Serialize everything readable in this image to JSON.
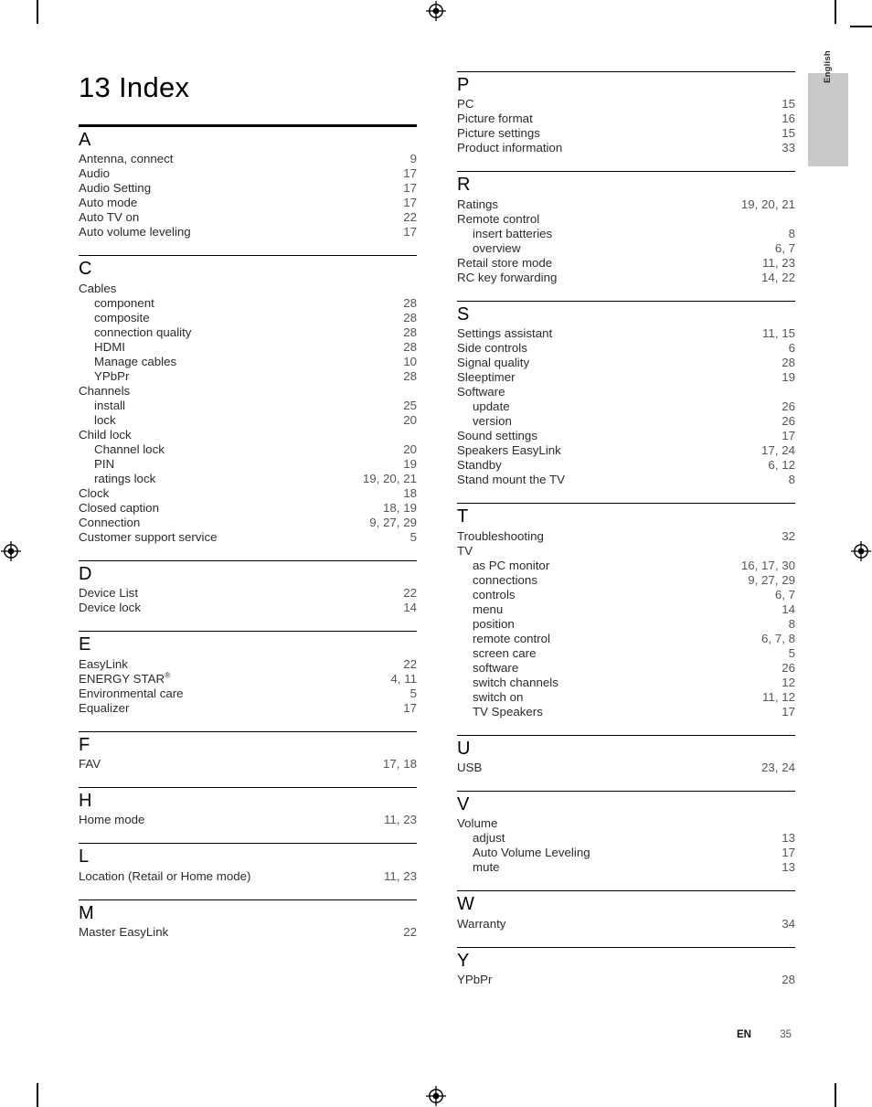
{
  "page": {
    "title": "13 Index",
    "language_tab": "English",
    "footer": {
      "language_code": "EN",
      "page_number": "35"
    }
  },
  "left_column": [
    {
      "letter": "A",
      "entries": [
        {
          "label": "Antenna, connect",
          "pages": "9",
          "sub": false
        },
        {
          "label": "Audio",
          "pages": "17",
          "sub": false
        },
        {
          "label": "Audio Setting",
          "pages": "17",
          "sub": false
        },
        {
          "label": "Auto mode",
          "pages": "17",
          "sub": false
        },
        {
          "label": "Auto TV on",
          "pages": "22",
          "sub": false
        },
        {
          "label": "Auto volume leveling",
          "pages": "17",
          "sub": false
        }
      ]
    },
    {
      "letter": "C",
      "entries": [
        {
          "label": "Cables",
          "pages": "",
          "sub": false
        },
        {
          "label": "component",
          "pages": "28",
          "sub": true
        },
        {
          "label": "composite",
          "pages": "28",
          "sub": true
        },
        {
          "label": "connection quality",
          "pages": "28",
          "sub": true
        },
        {
          "label": "HDMI",
          "pages": "28",
          "sub": true
        },
        {
          "label": "Manage cables",
          "pages": "10",
          "sub": true
        },
        {
          "label": "YPbPr",
          "pages": "28",
          "sub": true
        },
        {
          "label": "Channels",
          "pages": "",
          "sub": false
        },
        {
          "label": "install",
          "pages": "25",
          "sub": true
        },
        {
          "label": "lock",
          "pages": "20",
          "sub": true
        },
        {
          "label": "Child lock",
          "pages": "",
          "sub": false
        },
        {
          "label": "Channel lock",
          "pages": "20",
          "sub": true
        },
        {
          "label": "PIN",
          "pages": "19",
          "sub": true
        },
        {
          "label": "ratings lock",
          "pages": "19, 20, 21",
          "sub": true
        },
        {
          "label": "Clock",
          "pages": "18",
          "sub": false
        },
        {
          "label": "Closed caption",
          "pages": "18, 19",
          "sub": false
        },
        {
          "label": "Connection",
          "pages": "9, 27, 29",
          "sub": false
        },
        {
          "label": "Customer support service",
          "pages": "5",
          "sub": false
        }
      ]
    },
    {
      "letter": "D",
      "entries": [
        {
          "label": "Device List",
          "pages": "22",
          "sub": false
        },
        {
          "label": "Device lock",
          "pages": "14",
          "sub": false
        }
      ]
    },
    {
      "letter": "E",
      "entries": [
        {
          "label": "EasyLink",
          "pages": "22",
          "sub": false
        },
        {
          "label": "ENERGY STAR",
          "superscript": "®",
          "pages": "4, 11",
          "sub": false
        },
        {
          "label": "Environmental care",
          "pages": "5",
          "sub": false
        },
        {
          "label": "Equalizer",
          "pages": "17",
          "sub": false
        }
      ]
    },
    {
      "letter": "F",
      "entries": [
        {
          "label": "FAV",
          "pages": "17, 18",
          "sub": false
        }
      ]
    },
    {
      "letter": "H",
      "entries": [
        {
          "label": "Home mode",
          "pages": "11, 23",
          "sub": false
        }
      ]
    },
    {
      "letter": "L",
      "entries": [
        {
          "label": "Location (Retail or Home mode)",
          "pages": "11, 23",
          "sub": false
        }
      ]
    },
    {
      "letter": "M",
      "entries": [
        {
          "label": "Master EasyLink",
          "pages": "22",
          "sub": false
        }
      ]
    }
  ],
  "right_column": [
    {
      "letter": "P",
      "entries": [
        {
          "label": "PC",
          "pages": "15",
          "sub": false
        },
        {
          "label": "Picture format",
          "pages": "16",
          "sub": false
        },
        {
          "label": "Picture settings",
          "pages": "15",
          "sub": false
        },
        {
          "label": "Product information",
          "pages": "33",
          "sub": false
        }
      ]
    },
    {
      "letter": "R",
      "entries": [
        {
          "label": "Ratings",
          "pages": "19, 20, 21",
          "sub": false
        },
        {
          "label": "Remote control",
          "pages": "",
          "sub": false
        },
        {
          "label": "insert batteries",
          "pages": "8",
          "sub": true
        },
        {
          "label": "overview",
          "pages": "6, 7",
          "sub": true
        },
        {
          "label": "Retail store mode",
          "pages": "11, 23",
          "sub": false
        },
        {
          "label": "RC key forwarding",
          "pages": "14, 22",
          "sub": false
        }
      ]
    },
    {
      "letter": "S",
      "entries": [
        {
          "label": "Settings assistant",
          "pages": "11, 15",
          "sub": false
        },
        {
          "label": "Side controls",
          "pages": "6",
          "sub": false
        },
        {
          "label": "Signal quality",
          "pages": "28",
          "sub": false
        },
        {
          "label": "Sleeptimer",
          "pages": "19",
          "sub": false
        },
        {
          "label": "Software",
          "pages": "",
          "sub": false
        },
        {
          "label": "update",
          "pages": "26",
          "sub": true
        },
        {
          "label": "version",
          "pages": "26",
          "sub": true
        },
        {
          "label": "Sound settings",
          "pages": "17",
          "sub": false
        },
        {
          "label": "Speakers EasyLink",
          "pages": "17, 24",
          "sub": false
        },
        {
          "label": "Standby",
          "pages": "6, 12",
          "sub": false
        },
        {
          "label": "Stand mount the TV",
          "pages": "8",
          "sub": false
        }
      ]
    },
    {
      "letter": "T",
      "entries": [
        {
          "label": "Troubleshooting",
          "pages": "32",
          "sub": false
        },
        {
          "label": "TV",
          "pages": "",
          "sub": false
        },
        {
          "label": "as PC monitor",
          "pages": "16, 17, 30",
          "sub": true
        },
        {
          "label": "connections",
          "pages": "9, 27, 29",
          "sub": true
        },
        {
          "label": "controls",
          "pages": "6, 7",
          "sub": true
        },
        {
          "label": "menu",
          "pages": "14",
          "sub": true
        },
        {
          "label": "position",
          "pages": "8",
          "sub": true
        },
        {
          "label": "remote control",
          "pages": "6, 7, 8",
          "sub": true
        },
        {
          "label": "screen care",
          "pages": "5",
          "sub": true
        },
        {
          "label": "software",
          "pages": "26",
          "sub": true
        },
        {
          "label": "switch channels",
          "pages": "12",
          "sub": true
        },
        {
          "label": "switch on",
          "pages": "11, 12",
          "sub": true
        },
        {
          "label": "TV Speakers",
          "pages": "17",
          "sub": true
        }
      ]
    },
    {
      "letter": "U",
      "entries": [
        {
          "label": "USB",
          "pages": "23, 24",
          "sub": false
        }
      ]
    },
    {
      "letter": "V",
      "entries": [
        {
          "label": "Volume",
          "pages": "",
          "sub": false
        },
        {
          "label": "adjust",
          "pages": "13",
          "sub": true
        },
        {
          "label": "Auto Volume Leveling",
          "pages": "17",
          "sub": true
        },
        {
          "label": "mute",
          "pages": "13",
          "sub": true
        }
      ]
    },
    {
      "letter": "W",
      "entries": [
        {
          "label": "Warranty",
          "pages": "34",
          "sub": false
        }
      ]
    },
    {
      "letter": "Y",
      "entries": [
        {
          "label": "YPbPr",
          "pages": "28",
          "sub": false
        }
      ]
    }
  ]
}
